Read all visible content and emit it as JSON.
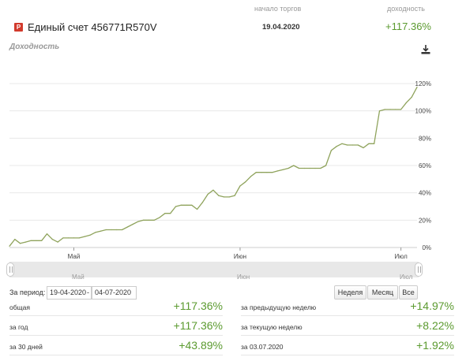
{
  "header": {
    "start_label": "начало торгов",
    "yield_label": "доходность",
    "account_name": "Единый счет 456771R570V",
    "account_icon": "Р",
    "start_date": "19.04.2020",
    "total_yield": "+117.36%"
  },
  "chart_title": "Доходность",
  "chart_data": {
    "type": "line",
    "title": "Доходность",
    "color": "#8fa35c",
    "x_tick_labels": [
      "Май",
      "Июн",
      "Июл"
    ],
    "y_tick_labels": [
      "0%",
      "20%",
      "40%",
      "60%",
      "80%",
      "100%",
      "120%"
    ],
    "ylim": [
      0,
      120
    ],
    "grid": true,
    "x": [
      "19.04",
      "20.04",
      "21.04",
      "22.04",
      "23.04",
      "24.04",
      "25.04",
      "26.04",
      "27.04",
      "28.04",
      "29.04",
      "30.04",
      "01.05",
      "02.05",
      "03.05",
      "04.05",
      "05.05",
      "06.05",
      "07.05",
      "08.05",
      "09.05",
      "10.05",
      "11.05",
      "12.05",
      "13.05",
      "14.05",
      "15.05",
      "16.05",
      "17.05",
      "18.05",
      "19.05",
      "20.05",
      "21.05",
      "22.05",
      "23.05",
      "24.05",
      "25.05",
      "26.05",
      "27.05",
      "28.05",
      "29.05",
      "30.05",
      "31.05",
      "01.06",
      "02.06",
      "03.06",
      "04.06",
      "05.06",
      "06.06",
      "07.06",
      "08.06",
      "09.06",
      "10.06",
      "11.06",
      "12.06",
      "13.06",
      "14.06",
      "15.06",
      "16.06",
      "17.06",
      "18.06",
      "19.06",
      "20.06",
      "21.06",
      "22.06",
      "23.06",
      "24.06",
      "25.06",
      "26.06",
      "27.06",
      "28.06",
      "29.06",
      "30.06",
      "01.07",
      "02.07",
      "03.07",
      "04.07"
    ],
    "values": [
      1,
      6,
      3,
      4,
      5,
      5,
      5,
      10,
      6,
      4,
      7,
      7,
      7,
      7,
      8,
      9,
      11,
      12,
      13,
      13,
      13,
      13,
      15,
      17,
      19,
      20,
      20,
      20,
      22,
      25,
      25,
      30,
      31,
      31,
      31,
      28,
      33,
      39,
      42,
      38,
      37,
      37,
      38,
      45,
      48,
      52,
      55,
      55,
      55,
      55,
      56,
      57,
      58,
      60,
      58,
      58,
      58,
      58,
      58,
      60,
      71,
      74,
      76,
      75,
      75,
      75,
      73,
      76,
      76,
      100,
      101,
      101,
      101,
      101,
      106,
      110,
      117.36
    ]
  },
  "navigator": {
    "labels": [
      "Май",
      "Июн",
      "Июл"
    ]
  },
  "period": {
    "label": "За период:",
    "from": "19-04-2020",
    "dash": "-",
    "to": "04-07-2020",
    "buttons": {
      "week": "Неделя",
      "month": "Месяц",
      "all": "Все"
    }
  },
  "stats": {
    "left": [
      {
        "label": "общая",
        "value": "+117.36%"
      },
      {
        "label": "за год",
        "value": "+117.36%"
      },
      {
        "label": "за 30 дней",
        "value": "+43.89%"
      }
    ],
    "right": [
      {
        "label": "за предыдущую неделю",
        "value": "+14.97%"
      },
      {
        "label": "за текущую неделю",
        "value": "+8.22%"
      },
      {
        "label": "за 03.07.2020",
        "value": "+1.92%"
      }
    ]
  }
}
